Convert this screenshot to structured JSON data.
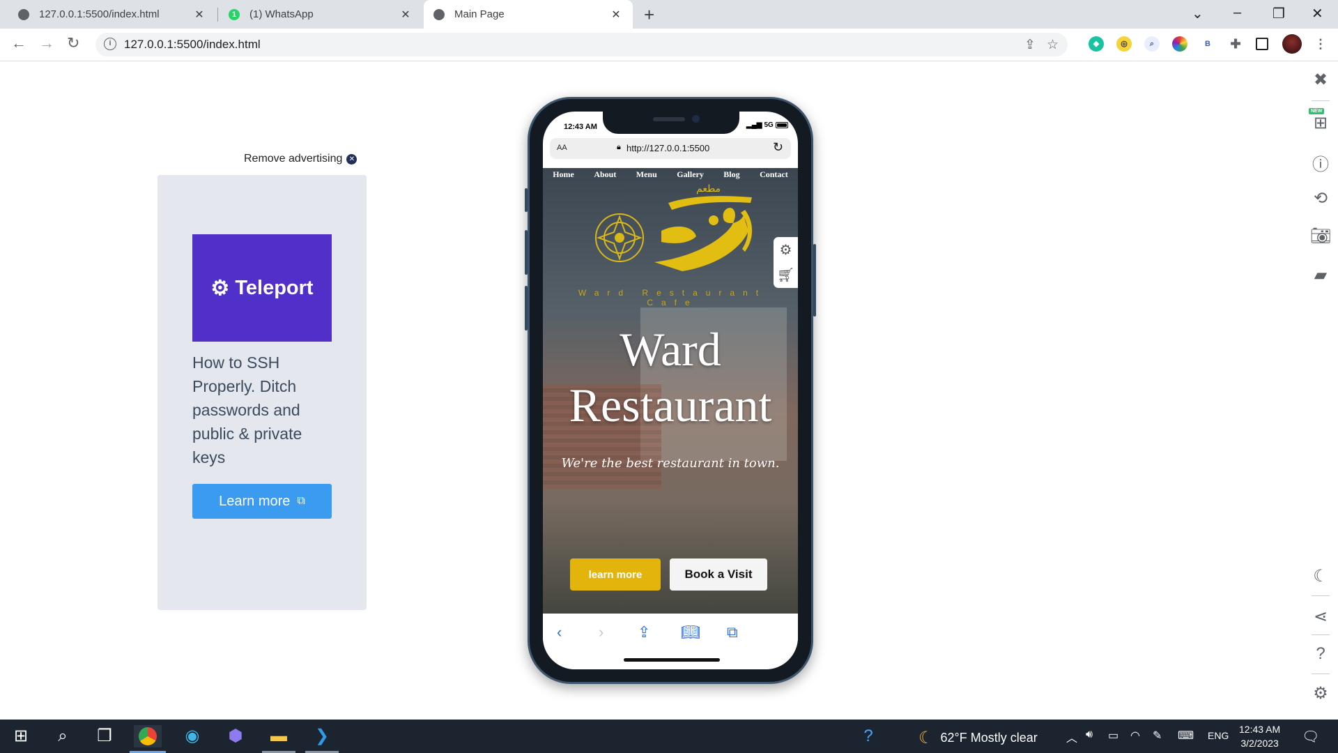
{
  "browser": {
    "tabs": [
      {
        "title": "127.0.0.1:5500/index.html",
        "close": "✕"
      },
      {
        "title": "(1) WhatsApp",
        "close": "✕",
        "badge": "1"
      },
      {
        "title": "Main Page",
        "close": "✕"
      }
    ],
    "new_tab": "+",
    "address": "127.0.0.1:5500/index.html",
    "extensions": [
      "bitwarden-icon",
      "norton-icon",
      "lens-icon",
      "color-icon",
      "b-icon",
      "puzzle-icon",
      "sidepanel-icon",
      "avatar"
    ],
    "ext_b_label": "B"
  },
  "ad": {
    "remove_label": "Remove advertising",
    "brand": "Teleport",
    "headline": "How to SSH Properly. Ditch passwords and public & private keys",
    "button_label": "Learn more"
  },
  "phone": {
    "status_time": "12:43 AM",
    "network": "5G",
    "safari_aa": "AA",
    "safari_url": "http://127.0.0.1:5500",
    "nav": [
      "Home",
      "About",
      "Menu",
      "Gallery",
      "Blog",
      "Contact"
    ],
    "logo_arabic": "مطعم",
    "logo_subtitle": "Ward Restaurant Cafe",
    "hero_title_line1": "Ward",
    "hero_title_line2": "Restaurant",
    "hero_tagline": "We're the best restaurant in town.",
    "btn_learn": "learn more",
    "btn_book": "Book a Visit"
  },
  "sidebar_badge": "NEW",
  "taskbar": {
    "weather": "62°F  Mostly clear",
    "lang": "ENG",
    "time": "12:43 AM",
    "date": "3/2/2023"
  },
  "colors": {
    "accent_yellow": "#e3b40b",
    "teleport_purple": "#512fc9",
    "ad_button_blue": "#3a9bf0",
    "taskbar_bg": "#1c2430"
  }
}
